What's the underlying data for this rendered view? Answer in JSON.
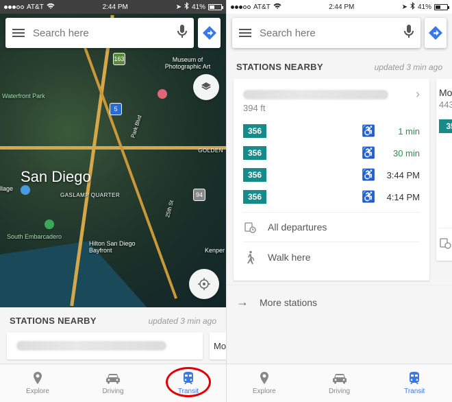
{
  "status": {
    "carrier": "AT&T",
    "time": "2:44 PM",
    "battery": "41%",
    "bt_icon": "bt"
  },
  "search": {
    "placeholder": "Search here"
  },
  "map": {
    "city_label": "San Diego",
    "areas": [
      "Waterfront Park",
      "GASLAMP QUARTER",
      "South Embarcadero",
      "GOLDEN",
      "llage",
      "Kenper"
    ],
    "pois": [
      "Museum of Photographic Art",
      "Hilton San Diego Bayfront"
    ],
    "shields": [
      "5",
      "163",
      "94"
    ],
    "streets": [
      "Park Blvd",
      "25th St"
    ]
  },
  "stations": {
    "header": "STATIONS NEARBY",
    "updated": "updated 3 min ago",
    "card": {
      "distance": "394 ft",
      "rows": [
        {
          "route": "356",
          "eta": "1 min",
          "green": true
        },
        {
          "route": "356",
          "eta": "30 min",
          "green": true
        },
        {
          "route": "356",
          "eta": "3:44 PM",
          "green": false
        },
        {
          "route": "356",
          "eta": "4:14 PM",
          "green": false
        }
      ],
      "all_departures": "All departures",
      "walk_here": "Walk here"
    },
    "more": "More stations",
    "peek": {
      "name_initial": "Mo",
      "dist": "443",
      "route": "35"
    }
  },
  "tabs": {
    "explore": "Explore",
    "driving": "Driving",
    "transit": "Transit"
  }
}
